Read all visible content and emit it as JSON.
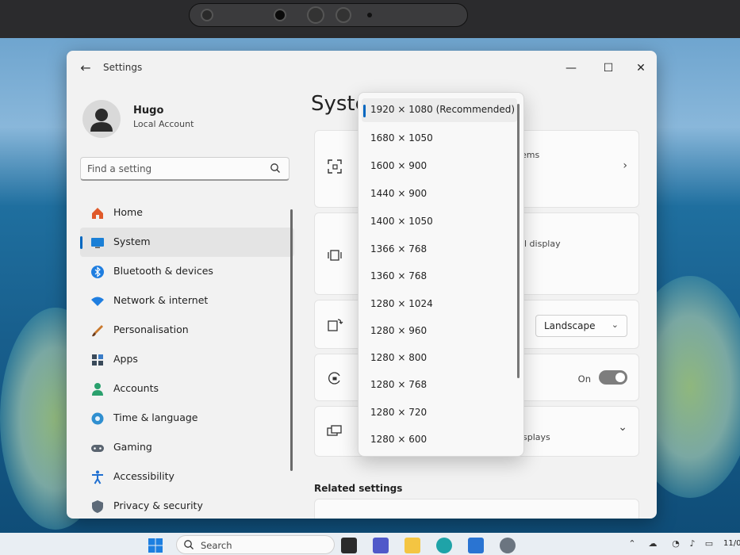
{
  "window": {
    "title": "Settings"
  },
  "window_controls": {
    "minimize": "—",
    "maximize": "☐",
    "close": "✕"
  },
  "profile": {
    "name": "Hugo",
    "account_type": "Local Account"
  },
  "search": {
    "placeholder": "Find a setting"
  },
  "sidebar": {
    "items": [
      {
        "label": "Home",
        "icon": "home-icon"
      },
      {
        "label": "System",
        "icon": "system-icon",
        "selected": true
      },
      {
        "label": "Bluetooth & devices",
        "icon": "bluetooth-icon"
      },
      {
        "label": "Network & internet",
        "icon": "wifi-icon"
      },
      {
        "label": "Personalisation",
        "icon": "brush-icon"
      },
      {
        "label": "Apps",
        "icon": "apps-icon"
      },
      {
        "label": "Accounts",
        "icon": "accounts-icon"
      },
      {
        "label": "Time & language",
        "icon": "globe-icon"
      },
      {
        "label": "Gaming",
        "icon": "gamepad-icon"
      },
      {
        "label": "Accessibility",
        "icon": "accessibility-icon"
      },
      {
        "label": "Privacy & security",
        "icon": "shield-icon"
      }
    ]
  },
  "main": {
    "page_title": "Syste",
    "cards": [
      {
        "partial_text": "ems",
        "icon": "scale-icon"
      },
      {
        "partial_text": "l display",
        "icon": "resolution-icon"
      },
      {
        "icon": "orientation-icon",
        "select_value": "Landscape"
      },
      {
        "icon": "rotation-lock-icon",
        "toggle_label": "On"
      },
      {
        "partial_text": "splays",
        "icon": "multiple-displays-icon"
      }
    ],
    "related_heading": "Related settings"
  },
  "resolution_dropdown": {
    "options": [
      "1920 × 1080 (Recommended)",
      "1680 × 1050",
      "1600 × 900",
      "1440 × 900",
      "1400 × 1050",
      "1366 × 768",
      "1360 × 768",
      "1280 × 1024",
      "1280 × 960",
      "1280 × 800",
      "1280 × 768",
      "1280 × 720",
      "1280 × 600"
    ],
    "selected_index": 0
  },
  "taskbar": {
    "search_label": "Search",
    "clock_partial": "11/0"
  },
  "colors": {
    "accent": "#0067c0"
  }
}
